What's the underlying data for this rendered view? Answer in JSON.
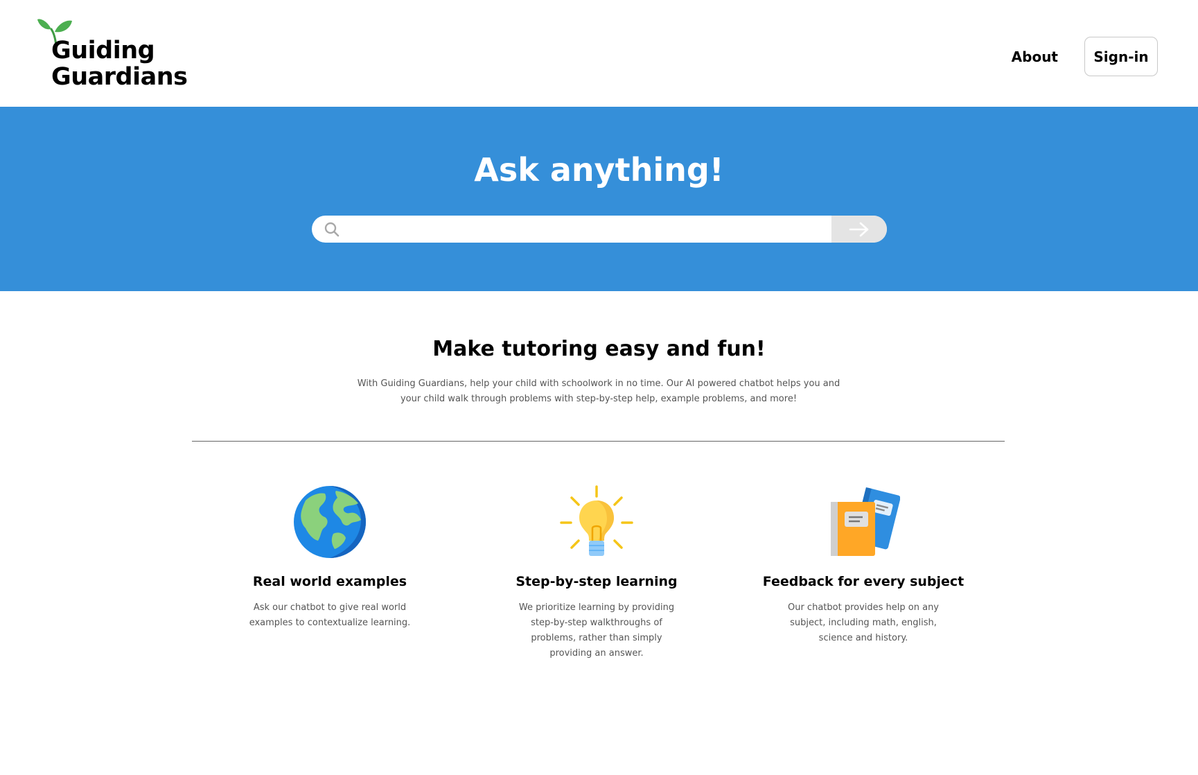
{
  "header": {
    "logo_line1": "Guiding",
    "logo_line2": "Guardians",
    "nav": {
      "about_label": "About",
      "signin_label": "Sign-in"
    }
  },
  "hero": {
    "title": "Ask anything!",
    "search": {
      "value": "",
      "placeholder": ""
    }
  },
  "intro": {
    "title": "Make tutoring easy and fun!",
    "text": "With Guiding Guardians, help your child with schoolwork in no time. Our AI powered chatbot helps you and your child walk through problems with step-by-step help, example problems, and more!"
  },
  "features": [
    {
      "icon": "globe-icon",
      "title": "Real world examples",
      "description": "Ask our chatbot to give real world examples to contextualize learning."
    },
    {
      "icon": "lightbulb-icon",
      "title": "Step-by-step learning",
      "description": "We prioritize learning by providing step-by-step walkthroughs of problems, rather than simply providing an answer."
    },
    {
      "icon": "books-icon",
      "title": "Feedback for every subject",
      "description": "Our chatbot provides help on any subject, including math, english, science and history."
    }
  ],
  "colors": {
    "hero_background": "#358fd9",
    "sprout_green": "#4caf50",
    "submit_background": "#e4e4e4"
  }
}
